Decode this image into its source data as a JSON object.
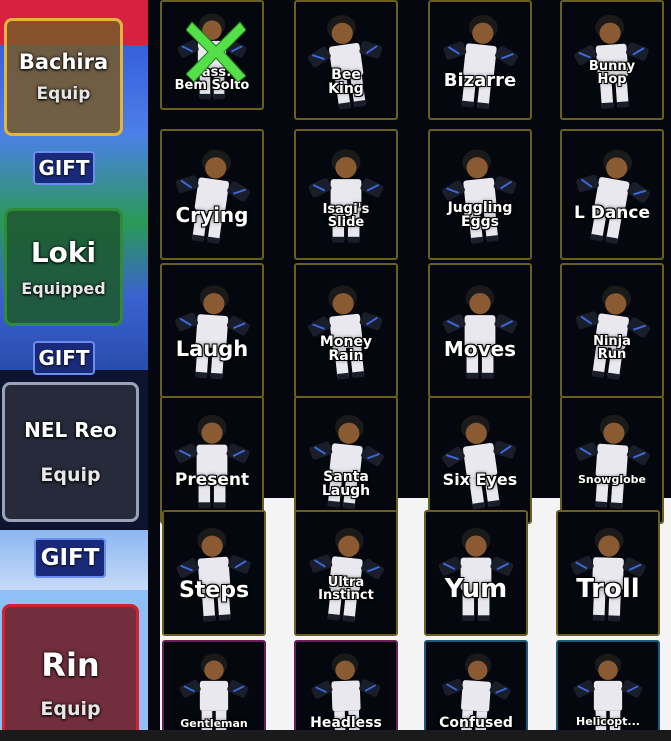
{
  "left_panel": {
    "cards": [
      {
        "name": "Bachira",
        "status": "Equip"
      },
      {
        "name": "Loki",
        "status": "Equipped"
      },
      {
        "name": "NEL Reo",
        "status": "Equip"
      },
      {
        "name": "Rin",
        "status": "Equip"
      }
    ],
    "gift_label": "GIFT"
  },
  "emotes": [
    {
      "label": "Pass:\nBem Solto"
    },
    {
      "label": "Bee\nKing"
    },
    {
      "label": "Bizarre"
    },
    {
      "label": "Bunny\nHop"
    },
    {
      "label": "Crying"
    },
    {
      "label": "Isagi's\nSlide"
    },
    {
      "label": "Juggling\nEggs"
    },
    {
      "label": "L Dance"
    },
    {
      "label": "Laugh"
    },
    {
      "label": "Money\nRain"
    },
    {
      "label": "Moves"
    },
    {
      "label": "Ninja\nRun"
    },
    {
      "label": "Present"
    },
    {
      "label": "Santa\nLaugh"
    },
    {
      "label": "Six Eyes"
    },
    {
      "label": "Snowglobe"
    },
    {
      "label": "Steps"
    },
    {
      "label": "Ultra\nInstinct"
    },
    {
      "label": "Yum"
    },
    {
      "label": "Troll"
    },
    {
      "label": "Gentleman"
    },
    {
      "label": "Headless"
    },
    {
      "label": "Confused"
    },
    {
      "label": "Helicopt..."
    }
  ],
  "colors": {
    "close_x": "#55e04a",
    "tile_border_gold": "#6a5f1e",
    "bachira_border": "#e3b53c",
    "loki_border": "#2f8a3a",
    "reo_border": "#9aa3b5",
    "rin_border": "#d52030"
  },
  "close_icon": "x-close-icon"
}
